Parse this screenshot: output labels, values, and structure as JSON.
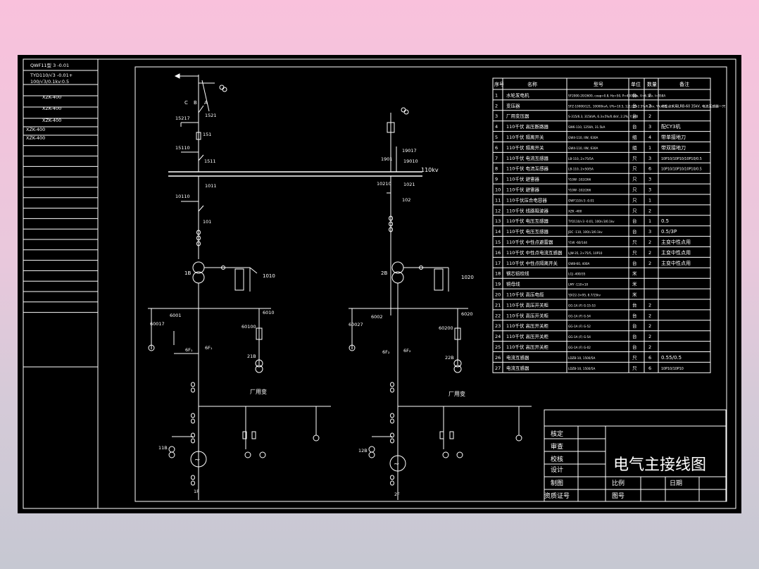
{
  "sidebar_rows": [
    "QWF11型 3 -0.01",
    "TYD110/√3 -0.01+",
    "100/√3/0.1kv:0.5",
    "XZK-400",
    "XZK-400",
    "XZK-400",
    "XZK-400",
    "XZK-400"
  ],
  "labels": {
    "left": {
      "phases": [
        "C",
        "B",
        "A"
      ],
      "sw_top": "1521",
      "sw_top_ground": "15217",
      "cb_top": "151",
      "cb_ground": "15110",
      "sw_bus": "1511",
      "sw_below_bus": "1011",
      "sw_below_ground": "10110",
      "cb_main": "101",
      "transformer": "1B",
      "neutral_sw": "1010",
      "sw_6001": "6001",
      "sw_60017": "60017",
      "sw_6010": "6010",
      "sw_60100": "60100",
      "cb_6fl": "6F₁",
      "cb_6f": "6F₁",
      "aux_tr": "21B",
      "aux_label": "厂用变",
      "gen_tr": "11B",
      "gen": "1F"
    },
    "right": {
      "sw_top": "19017",
      "sw_ground_top": "1901",
      "sw_1901": "19010",
      "sw_1021": "1021",
      "sw_10210": "10210",
      "cb_main": "102",
      "transformer": "2B",
      "neutral_sw": "1020",
      "sw_6002": "6002",
      "sw_60027": "60027",
      "sw_6020": "6020",
      "sw_60200": "60200",
      "cb_6fl": "6F₂",
      "cb_6f": "6F₂",
      "aux_tr": "22B",
      "aux_label": "厂用变",
      "gen_tr": "12B",
      "gen": "2F"
    },
    "bus": "110kv"
  },
  "table": {
    "headers": [
      "序号",
      "名称",
      "型号",
      "单位",
      "数量",
      "备注"
    ],
    "rows": [
      [
        "1",
        "水轮发电机",
        "SF2000-20/2600, cosφ=0.8, Hz=50, P=4000kw, V=6.3kv, I=458A",
        "台",
        "2",
        ""
      ],
      [
        "2",
        "变压器",
        "SFZ-10000/121, 10000kvA, U%=10.5, 121±2×2.5%/6.3kv, YN,d11",
        "台",
        "2",
        "中性点采用LRB-60 35kV, 电流互感器一只"
      ],
      [
        "3",
        "厂用变压器",
        "S-315/6.3, 315kVA, 6.3±5%/0.4kV, 2.2%, Y,yn0",
        "台",
        "2",
        ""
      ],
      [
        "4",
        "110千伏 高压断路器",
        "SW6-110, 1250A, 31.5kA",
        "台",
        "3",
        "配CY3机"
      ],
      [
        "5",
        "110千伏 隔离开关",
        "GW4-110, IIW, 630A",
        "组",
        "4",
        "带单接地刀"
      ],
      [
        "6",
        "110千伏 隔离开关",
        "GW4-110, IIW, 630A",
        "组",
        "1",
        "带双接地刀"
      ],
      [
        "7",
        "110千伏 电流互感器",
        "LB-110, 2×75/5A",
        "只",
        "3",
        "10P10/10P10/10P10/0.5"
      ],
      [
        "8",
        "110千伏 电流互感器",
        "LB-110, 2×50/5A",
        "只",
        "6",
        "10P10/10P10/10P10/0.5"
      ],
      [
        "9",
        "110千伏 避雷器",
        "Y10W -102/266",
        "只",
        "3",
        ""
      ],
      [
        "10",
        "110千伏 避雷器",
        "Y10W -102/266",
        "只",
        "3",
        ""
      ],
      [
        "11",
        "110千伏压合电容器",
        "OWF110/√3 -0.01",
        "只",
        "1",
        ""
      ],
      [
        "12",
        "110千伏 线路阻波器",
        "XZK -400",
        "只",
        "2",
        ""
      ],
      [
        "13",
        "110千伏 电压互感器",
        "TYD110/√3 -0.01, 100/√3/0.1kv",
        "台",
        "1",
        "0.5"
      ],
      [
        "14",
        "110千伏 电压互感器",
        "JDC -110, 100/√3/0.1kv",
        "台",
        "3",
        "0.5/3P"
      ],
      [
        "15",
        "110千伏 中性点避雷器",
        "Y1W -60/144",
        "只",
        "2",
        "主变中性点用"
      ],
      [
        "16",
        "110千伏 中性点电流互感器",
        "LJW-35, 2×75/5, 10P10",
        "只",
        "2",
        "主变中性点用"
      ],
      [
        "17",
        "110千伏 中性点隔离开关",
        "GW8-60, 400A",
        "台",
        "2",
        "主变中性点用"
      ],
      [
        "18",
        "钢芯铝绞线",
        "LGJ -400/35",
        "米",
        "",
        ""
      ],
      [
        "19",
        "铜母线",
        "LMY -110×10",
        "米",
        "",
        ""
      ],
      [
        "20",
        "110千伏 高压电缆",
        "YJV22-3×95, 8.7/15kv",
        "米",
        "",
        ""
      ],
      [
        "21",
        "110千伏 高压开关柜",
        "GG-1A (F) G-15-53",
        "台",
        "2",
        ""
      ],
      [
        "22",
        "110千伏 高压开关柜",
        "GG-1A (F) G-54",
        "台",
        "2",
        ""
      ],
      [
        "23",
        "110千伏 高压开关柜",
        "GG-1A (F) G-52",
        "台",
        "2",
        ""
      ],
      [
        "24",
        "110千伏 高压开关柜",
        "GG-1A (F) G-54",
        "台",
        "2",
        ""
      ],
      [
        "25",
        "110千伏 高压开关柜",
        "GG-1A (F) G-02",
        "台",
        "2",
        ""
      ],
      [
        "26",
        "电流互感器",
        "LDZB-10, 1500/5A",
        "只",
        "6",
        "0.55/0.5"
      ],
      [
        "27",
        "电流互感器",
        "LDZB-10, 1500/5A",
        "只",
        "6",
        "10P10/10P10"
      ]
    ]
  },
  "title_block": {
    "title": "电气主接线图",
    "rows": [
      "核定",
      "审查",
      "校核",
      "设计",
      "制图",
      "资质证号"
    ],
    "scale_label": "比例",
    "date_label": "日期",
    "drawing_no_label": "图号"
  },
  "colors": {
    "line": "#ffffff",
    "background": "#000000"
  }
}
